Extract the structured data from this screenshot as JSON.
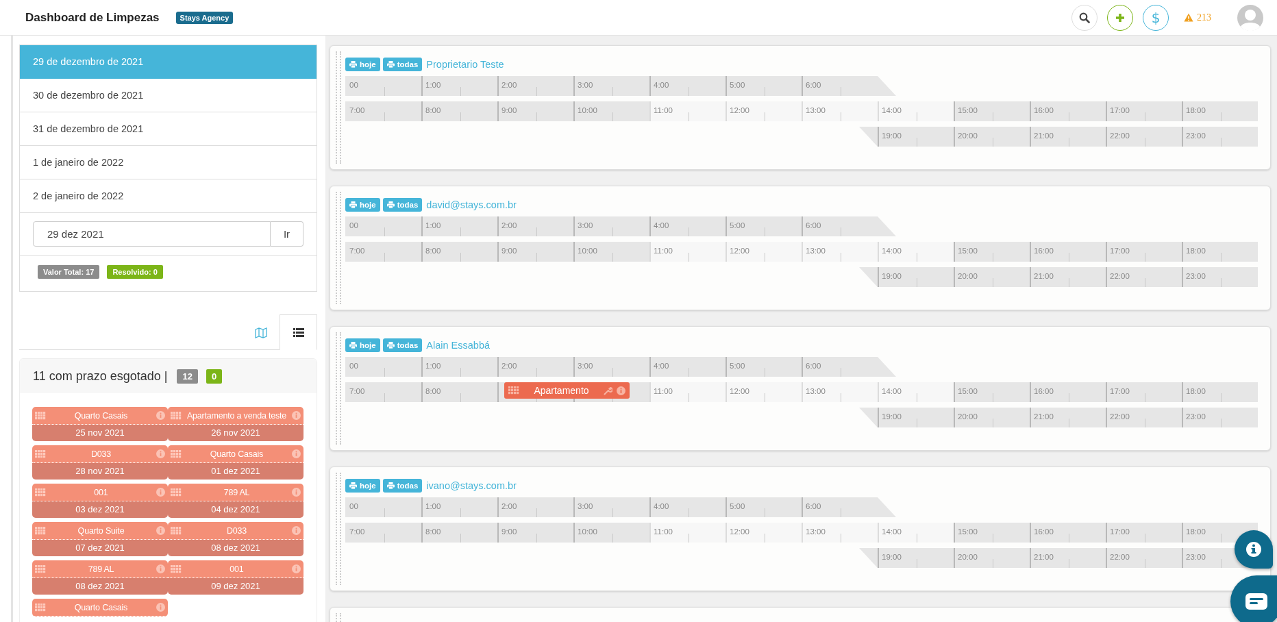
{
  "header": {
    "title": "Dashboard de Limpezas",
    "agency": "Stays Agency",
    "money_icon": "$",
    "alert_count": "213"
  },
  "dates": [
    {
      "label": "29 de dezembro de 2021",
      "selected": true
    },
    {
      "label": "30 de dezembro de 2021",
      "selected": false
    },
    {
      "label": "31 de dezembro de 2021",
      "selected": false
    },
    {
      "label": "1 de janeiro de 2022",
      "selected": false
    },
    {
      "label": "2 de janeiro de 2022",
      "selected": false
    }
  ],
  "date_field": {
    "value": "29 dez 2021",
    "button": "Ir"
  },
  "totals": [
    {
      "label": "Valor Total: 17",
      "color": "#8c8c8c"
    },
    {
      "label": "Resolvido: 0",
      "color": "#7cb518"
    }
  ],
  "view_tabs": [
    {
      "kind": "map",
      "selected": false
    },
    {
      "kind": "list",
      "selected": true
    }
  ],
  "overdue": {
    "title": "11 com prazo esgotado |",
    "counts": [
      {
        "label": "12",
        "color": "#8c8c8c"
      },
      {
        "label": "0",
        "color": "#7cb518"
      }
    ],
    "tasks": [
      {
        "name": "Quarto Casais",
        "date": "25 nov 2021"
      },
      {
        "name": "Apartamento a venda teste",
        "date": "26 nov 2021"
      },
      {
        "name": "D033",
        "date": "28 nov 2021"
      },
      {
        "name": "Quarto Casais",
        "date": "01 dez 2021"
      },
      {
        "name": "001",
        "date": "03 dez 2021"
      },
      {
        "name": "789 AL",
        "date": "04 dez 2021"
      },
      {
        "name": "Quarto Suite",
        "date": "07 dez 2021"
      },
      {
        "name": "D033",
        "date": "08 dez 2021"
      },
      {
        "name": "789 AL",
        "date": "08 dez 2021"
      },
      {
        "name": "001",
        "date": "09 dez 2021"
      },
      {
        "name": "Quarto Casais"
      }
    ]
  },
  "timelines": [
    {
      "buttons": [
        "hoje",
        "todas"
      ],
      "owner": "Proprietario Teste",
      "rows": [
        [
          {
            "label": "00",
            "light": false
          },
          {
            "label": "1:00",
            "light": false
          },
          {
            "label": "2:00",
            "light": false
          },
          {
            "label": "3:00",
            "light": false
          },
          {
            "label": "4:00",
            "light": false
          },
          {
            "label": "5:00",
            "light": false
          },
          {
            "label": "6:00",
            "light": false
          }
        ],
        [
          {
            "label": "7:00",
            "light": false
          },
          {
            "label": "8:00",
            "light": false
          },
          {
            "label": "9:00",
            "light": false
          },
          {
            "label": "10:00",
            "light": false
          },
          {
            "label": "11:00",
            "light": true
          },
          {
            "label": "12:00",
            "light": true
          },
          {
            "label": "13:00",
            "light": true
          },
          {
            "label": "14:00",
            "light": true
          },
          {
            "label": "15:00",
            "light": false
          },
          {
            "label": "16:00",
            "light": false
          },
          {
            "label": "17:00",
            "light": false
          },
          {
            "label": "18:00",
            "light": false
          }
        ],
        [
          null,
          null,
          null,
          null,
          null,
          null,
          null,
          {
            "label": "19:00",
            "light": false
          },
          {
            "label": "20:00",
            "light": false
          },
          {
            "label": "21:00",
            "light": false
          },
          {
            "label": "22:00",
            "light": false
          },
          {
            "label": "23:00",
            "light": false
          }
        ]
      ]
    },
    {
      "buttons": [
        "hoje",
        "todas"
      ],
      "owner": "david@stays.com.br",
      "rows": [
        [
          {
            "label": "00",
            "light": false
          },
          {
            "label": "1:00",
            "light": false
          },
          {
            "label": "2:00",
            "light": false
          },
          {
            "label": "3:00",
            "light": false
          },
          {
            "label": "4:00",
            "light": false
          },
          {
            "label": "5:00",
            "light": false
          },
          {
            "label": "6:00",
            "light": false
          }
        ],
        [
          {
            "label": "7:00",
            "light": false
          },
          {
            "label": "8:00",
            "light": false
          },
          {
            "label": "9:00",
            "light": false
          },
          {
            "label": "10:00",
            "light": false
          },
          {
            "label": "11:00",
            "light": true
          },
          {
            "label": "12:00",
            "light": true
          },
          {
            "label": "13:00",
            "light": true
          },
          {
            "label": "14:00",
            "light": true
          },
          {
            "label": "15:00",
            "light": false
          },
          {
            "label": "16:00",
            "light": false
          },
          {
            "label": "17:00",
            "light": false
          },
          {
            "label": "18:00",
            "light": false
          }
        ],
        [
          null,
          null,
          null,
          null,
          null,
          null,
          null,
          {
            "label": "19:00",
            "light": false
          },
          {
            "label": "20:00",
            "light": false
          },
          {
            "label": "21:00",
            "light": false
          },
          {
            "label": "22:00",
            "light": false
          },
          {
            "label": "23:00",
            "light": false
          }
        ]
      ]
    },
    {
      "buttons": [
        "hoje",
        "todas"
      ],
      "owner": "Alain Essabbá",
      "task": {
        "name": "Apartamento"
      },
      "rows": [
        [
          {
            "label": "00",
            "light": false
          },
          {
            "label": "1:00",
            "light": false
          },
          {
            "label": "2:00",
            "light": false
          },
          {
            "label": "3:00",
            "light": false
          },
          {
            "label": "4:00",
            "light": false
          },
          {
            "label": "5:00",
            "light": false
          },
          {
            "label": "6:00",
            "light": false
          }
        ],
        [
          {
            "label": "7:00",
            "light": false
          },
          {
            "label": "8:00",
            "light": false
          },
          {
            "light": false
          },
          {
            "light": false
          },
          {
            "label": "11:00",
            "light": true
          },
          {
            "label": "12:00",
            "light": true
          },
          {
            "label": "13:00",
            "light": true
          },
          {
            "label": "14:00",
            "light": true
          },
          {
            "label": "15:00",
            "light": false
          },
          {
            "label": "16:00",
            "light": false
          },
          {
            "label": "17:00",
            "light": false
          },
          {
            "label": "18:00",
            "light": false
          }
        ],
        [
          null,
          null,
          null,
          null,
          null,
          null,
          null,
          {
            "label": "19:00",
            "light": false
          },
          {
            "label": "20:00",
            "light": false
          },
          {
            "label": "21:00",
            "light": false
          },
          {
            "label": "22:00",
            "light": false
          },
          {
            "label": "23:00",
            "light": false
          }
        ]
      ]
    },
    {
      "buttons": [
        "hoje",
        "todas"
      ],
      "owner": "ivano@stays.com.br",
      "rows": [
        [
          {
            "label": "00",
            "light": false
          },
          {
            "label": "1:00",
            "light": false
          },
          {
            "label": "2:00",
            "light": false
          },
          {
            "label": "3:00",
            "light": false
          },
          {
            "label": "4:00",
            "light": false
          },
          {
            "label": "5:00",
            "light": false
          },
          {
            "label": "6:00",
            "light": false
          }
        ],
        [
          {
            "label": "7:00",
            "light": false
          },
          {
            "label": "8:00",
            "light": false
          },
          {
            "label": "9:00",
            "light": false
          },
          {
            "label": "10:00",
            "light": false
          },
          {
            "label": "11:00",
            "light": true
          },
          {
            "label": "12:00",
            "light": true
          },
          {
            "label": "13:00",
            "light": true
          },
          {
            "label": "14:00",
            "light": true
          },
          {
            "label": "15:00",
            "light": false
          },
          {
            "label": "16:00",
            "light": false
          },
          {
            "label": "17:00",
            "light": false
          },
          {
            "label": "18:00",
            "light": false
          }
        ],
        [
          null,
          null,
          null,
          null,
          null,
          null,
          null,
          {
            "label": "19:00",
            "light": false
          },
          {
            "label": "20:00",
            "light": false
          },
          {
            "label": "21:00",
            "light": false
          },
          {
            "label": "22:00",
            "light": false
          },
          {
            "label": "23:00",
            "light": false
          }
        ]
      ]
    }
  ]
}
